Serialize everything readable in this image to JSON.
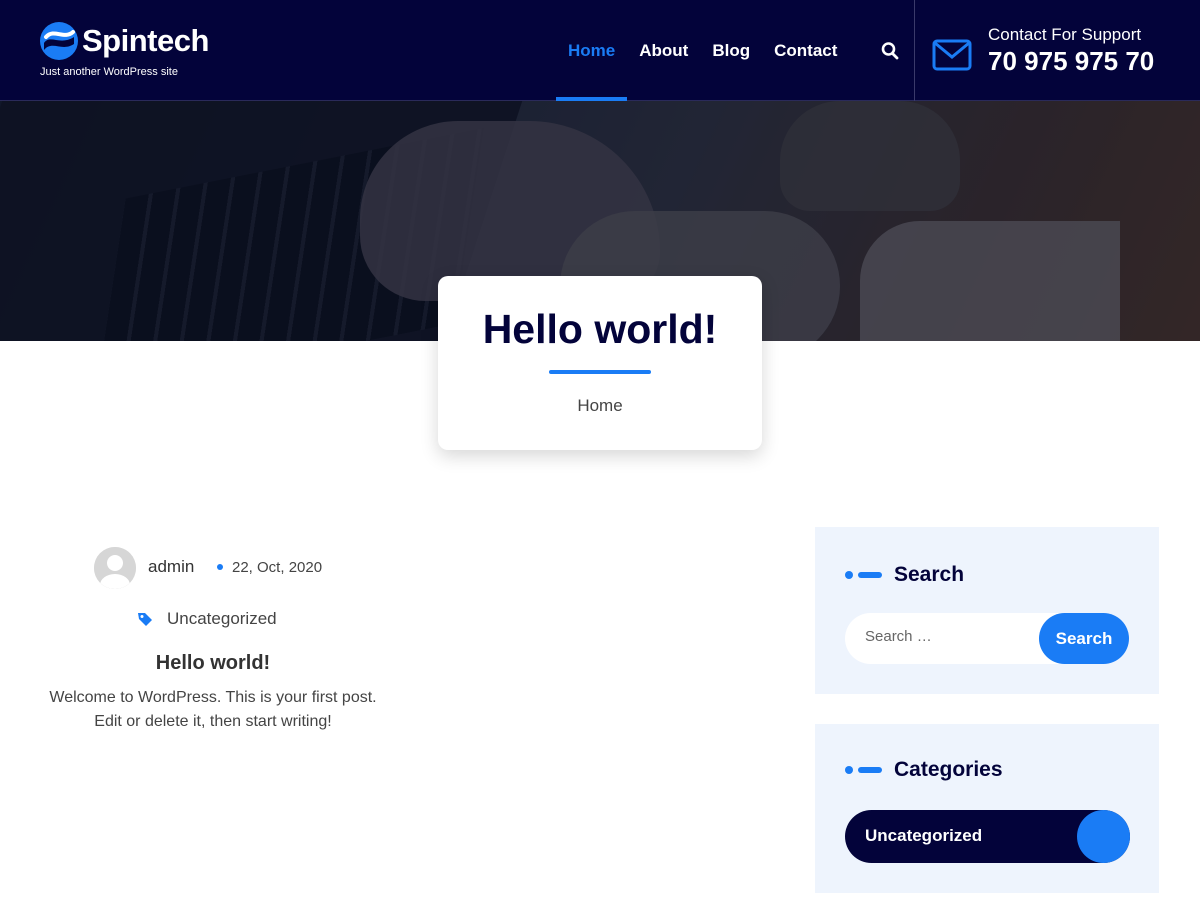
{
  "site": {
    "name": "Spintech",
    "tagline": "Just another WordPress site"
  },
  "nav": {
    "items": [
      {
        "label": "Home",
        "active": true
      },
      {
        "label": "About",
        "active": false
      },
      {
        "label": "Blog",
        "active": false
      },
      {
        "label": "Contact",
        "active": false
      }
    ],
    "search_icon": "search-icon"
  },
  "support": {
    "label": "Contact For Support",
    "phone": "70 975 975 70",
    "icon": "mail-icon"
  },
  "page": {
    "title": "Hello world!",
    "breadcrumb": "Home"
  },
  "post": {
    "author": "admin",
    "date": "22, Oct, 2020",
    "category": "Uncategorized",
    "title": "Hello world!",
    "excerpt": "Welcome to WordPress. This is your first post. Edit or delete it, then start writing!"
  },
  "sidebar": {
    "search": {
      "title": "Search",
      "placeholder": "Search …",
      "button": "Search"
    },
    "categories": {
      "title": "Categories",
      "items": [
        "Uncategorized"
      ]
    }
  },
  "colors": {
    "navy": "#03033a",
    "accent": "#1a7cf5",
    "widget_bg": "#eef4fd"
  }
}
